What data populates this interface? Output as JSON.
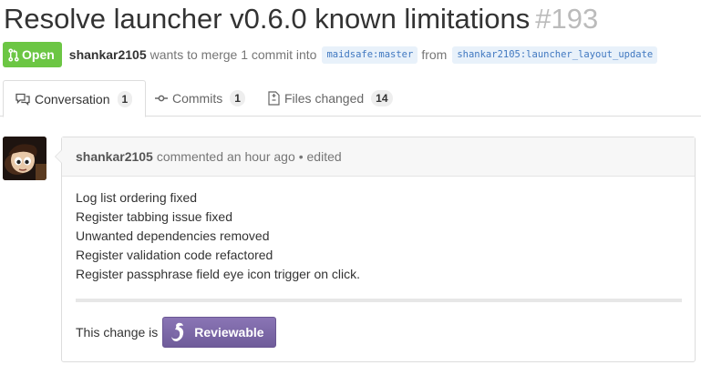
{
  "title": {
    "text": "Resolve launcher v0.6.0 known limitations",
    "number": "#193"
  },
  "meta": {
    "state": "Open",
    "author": "shankar2105",
    "text_before": "wants to merge 1 commit into",
    "base_ref": "maidsafe:master",
    "text_from": "from",
    "head_ref": "shankar2105:launcher_layout_update"
  },
  "tabs": [
    {
      "label": "Conversation",
      "count": "1",
      "icon": "comment-discussion-icon"
    },
    {
      "label": "Commits",
      "count": "1",
      "icon": "git-commit-icon"
    },
    {
      "label": "Files changed",
      "count": "14",
      "icon": "file-diff-icon"
    }
  ],
  "comment": {
    "author": "shankar2105",
    "action": "commented",
    "time": "an hour ago",
    "edited": "• edited",
    "lines": [
      "Log list ordering fixed",
      "Register tabbing issue fixed",
      "Unwanted dependencies removed",
      "Register validation code refactored",
      "Register passphrase field eye icon trigger on click."
    ]
  },
  "review": {
    "text": "This change is",
    "button": "Reviewable"
  },
  "colors": {
    "open_green": "#6cc644",
    "ref_blue": "#4078c0",
    "reviewable_purple": "#7e6aa9"
  }
}
